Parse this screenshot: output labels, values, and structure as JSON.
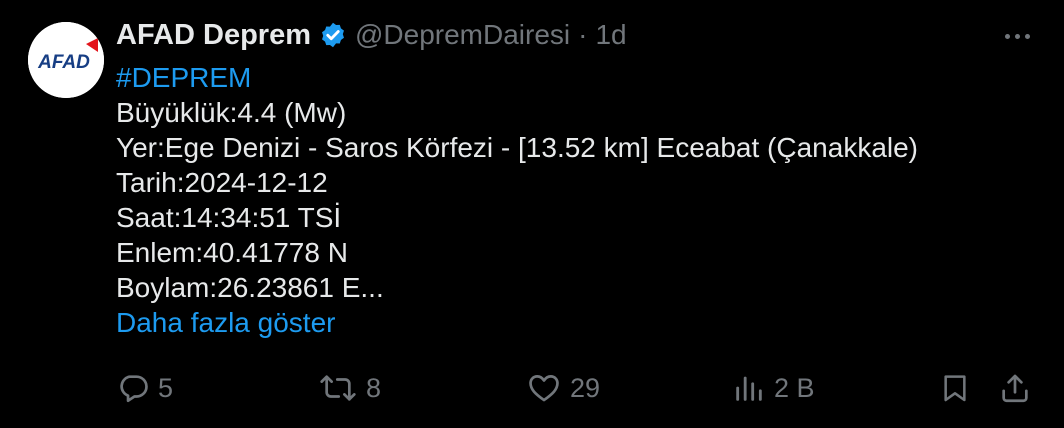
{
  "account": {
    "display_name": "AFAD Deprem",
    "handle": "@DepremDairesi",
    "separator": "·",
    "time": "1d",
    "avatar_text": "AFAD"
  },
  "tweet": {
    "hashtag": "#DEPREM",
    "lines": [
      "Büyüklük:4.4 (Mw)",
      "Yer:Ege Denizi - Saros Körfezi - [13.52 km] Eceabat (Çanakkale)",
      "Tarih:2024-12-12",
      "Saat:14:34:51 TSİ",
      "Enlem:40.41778 N",
      "Boylam:26.23861 E..."
    ],
    "show_more": "Daha fazla göster"
  },
  "actions": {
    "replies": "5",
    "reposts": "8",
    "likes": "29",
    "views": "2 B"
  },
  "colors": {
    "background": "#000000",
    "text": "#e7e9ea",
    "muted": "#71767b",
    "link": "#1d9bf0",
    "verified": "#1d9bf0",
    "brand_red": "#e3141b",
    "brand_blue": "#173e84"
  }
}
